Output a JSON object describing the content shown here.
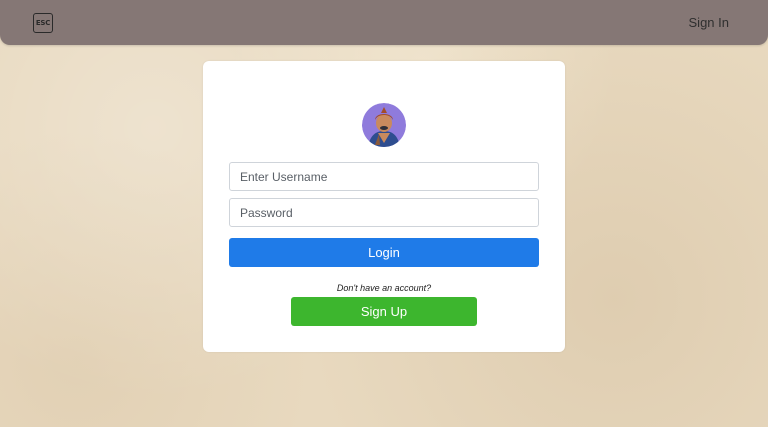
{
  "navbar": {
    "logo_text": "ESC",
    "signin_label": "Sign In"
  },
  "login_card": {
    "avatar_icon": "user-avatar-icon",
    "username_placeholder": "Enter Username",
    "password_placeholder": "Password",
    "login_label": "Login",
    "no_account_text": "Don't have an account?",
    "signup_label": "Sign Up"
  },
  "colors": {
    "navbar": "#857775",
    "background": "#e8d9bf",
    "login_button": "#1f7be8",
    "signup_button": "#3db62e",
    "avatar_background": "#8f7bdc"
  }
}
